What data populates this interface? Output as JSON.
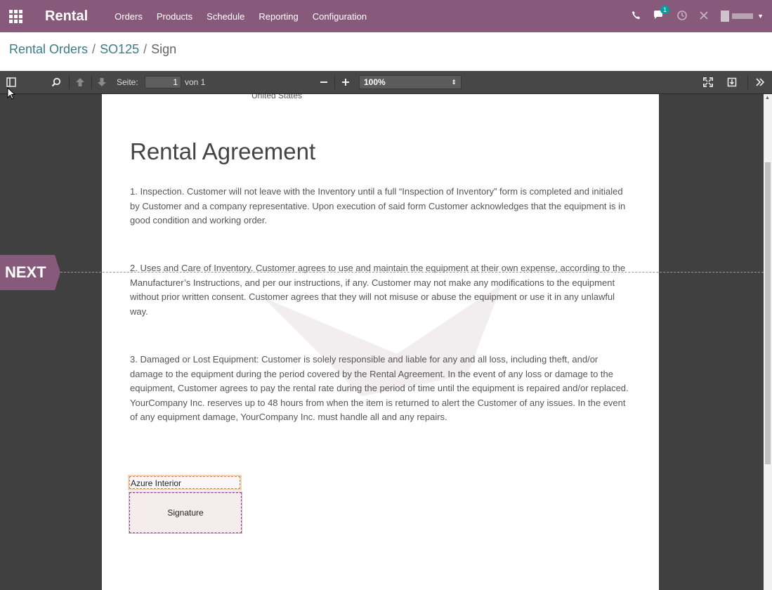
{
  "app": {
    "title": "Rental"
  },
  "nav": {
    "menu": [
      "Orders",
      "Products",
      "Schedule",
      "Reporting",
      "Configuration"
    ],
    "chat_badge": "1"
  },
  "breadcrumb": {
    "item1": "Rental Orders",
    "item2": "SO125",
    "current": "Sign",
    "separator": "/"
  },
  "pdf_toolbar": {
    "page_label": "Seite:",
    "page_value": "1",
    "page_of": "von 1",
    "zoom": "100%"
  },
  "document": {
    "address_partial": "United States",
    "title": "Rental Agreement",
    "paragraphs": [
      "1. Inspection. Customer will not leave with the  Inventory until a full “Inspection of Inventory” form is completed and initialed by Customer and a company representative. Upon execution of said form Customer acknowledges that the equipment is in good condition and working order.",
      "2. Uses and Care of Inventory. Customer agrees to use and maintain  the equipment at their own expense, according to the Manufacturer’s Instructions, and per our instructions, if any. Customer may not make any modifications to the equipment without prior written consent. Customer agrees that they will not misuse or abuse the equipment or use it in any unlawful way.",
      "3. Damaged or Lost Equipment: Customer is solely responsible and  liable for any and all loss, including theft, and/or damage to the equipment during the period covered by the Rental Agreement. In the event of any loss or damage to the equipment, Customer agrees to pay the rental rate during the period of time until the equipment is repaired and/or replaced. YourCompany Inc. reserves up to 48 hours from when the item is returned to alert the Customer of any issues. In the event of any equipment damage, YourCompany Inc. must handle all and any repairs."
    ],
    "name_field_value": "Azure Interior",
    "signature_label": "Signature"
  },
  "next_button": "NEXT",
  "colors": {
    "primary": "#875a7b",
    "link": "#3a7d85",
    "viewer_bg": "#404040"
  },
  "icons": [
    "apps-icon",
    "phone-icon",
    "chat-icon",
    "clock-icon",
    "close-icon",
    "sidebar-toggle-icon",
    "search-icon",
    "arrow-up-icon",
    "arrow-down-icon",
    "fullscreen-icon",
    "download-icon",
    "more-icon"
  ]
}
